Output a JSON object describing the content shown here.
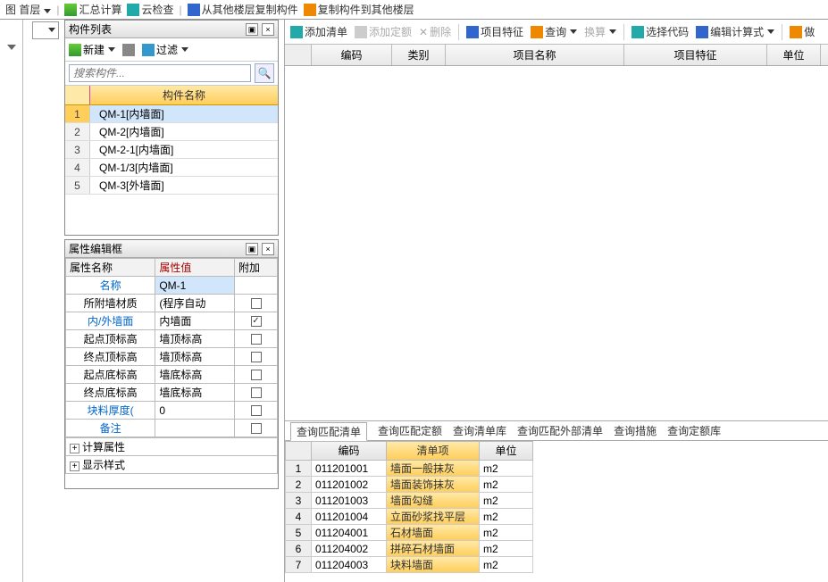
{
  "top_menu": {
    "floor_label": "图 首层",
    "summary_calc": "汇总计算",
    "cloud_check": "云检查",
    "copy_from": "从其他楼层复制构件",
    "copy_to": "复制构件到其他楼层"
  },
  "component_panel": {
    "title": "构件列表",
    "new_btn": "新建",
    "filter_btn": "过滤",
    "search_placeholder": "搜索构件...",
    "header": "构件名称",
    "rows": [
      {
        "idx": "1",
        "name": "QM-1[内墙面]"
      },
      {
        "idx": "2",
        "name": "QM-2[内墙面]"
      },
      {
        "idx": "3",
        "name": "QM-2-1[内墙面]"
      },
      {
        "idx": "4",
        "name": "QM-1/3[内墙面]"
      },
      {
        "idx": "5",
        "name": "QM-3[外墙面]"
      }
    ]
  },
  "prop_panel": {
    "title": "属性编辑框",
    "headers": {
      "name": "属性名称",
      "value": "属性值",
      "extra": "附加"
    },
    "rows": [
      {
        "key": "名称",
        "key_link": true,
        "val": "QM-1",
        "sel": true,
        "chk": null
      },
      {
        "key": "所附墙材质",
        "val": "(程序自动",
        "chk": false
      },
      {
        "key": "内/外墙面",
        "key_link": true,
        "val": "内墙面",
        "chk": true
      },
      {
        "key": "起点顶标高",
        "val": "墙顶标高",
        "chk": false
      },
      {
        "key": "终点顶标高",
        "val": "墙顶标高",
        "chk": false
      },
      {
        "key": "起点底标高",
        "val": "墙底标高",
        "chk": false
      },
      {
        "key": "终点底标高",
        "val": "墙底标高",
        "chk": false
      },
      {
        "key": "块料厚度(",
        "key_link": true,
        "val": "0",
        "chk": false
      },
      {
        "key": "备注",
        "key_link": true,
        "val": "",
        "chk": false
      }
    ],
    "tree": [
      {
        "label": "计算属性"
      },
      {
        "label": "显示样式"
      }
    ]
  },
  "right": {
    "toolbar": {
      "add_list": "添加清单",
      "add_quota": "添加定额",
      "delete": "删除",
      "proj_feat": "项目特征",
      "query": "查询",
      "convert": "换算",
      "select_code": "选择代码",
      "edit_calc": "编辑计算式",
      "do_method": "做"
    },
    "grid_headers": {
      "code": "编码",
      "type": "类别",
      "proj_name": "项目名称",
      "proj_feat": "项目特征",
      "unit": "单位"
    },
    "result_tabs": {
      "t1": "查询匹配清单",
      "t2": "查询匹配定额",
      "t3": "查询清单库",
      "t4": "查询匹配外部清单",
      "t5": "查询措施",
      "t6": "查询定额库"
    },
    "result_headers": {
      "code": "编码",
      "item": "清单项",
      "unit": "单位"
    },
    "result_rows": [
      {
        "idx": "1",
        "code": "011201001",
        "item": "墙面一般抹灰",
        "unit": "m2"
      },
      {
        "idx": "2",
        "code": "011201002",
        "item": "墙面装饰抹灰",
        "unit": "m2"
      },
      {
        "idx": "3",
        "code": "011201003",
        "item": "墙面勾缝",
        "unit": "m2"
      },
      {
        "idx": "4",
        "code": "011201004",
        "item": "立面砂浆找平层",
        "unit": "m2"
      },
      {
        "idx": "5",
        "code": "011204001",
        "item": "石材墙面",
        "unit": "m2"
      },
      {
        "idx": "6",
        "code": "011204002",
        "item": "拼碎石材墙面",
        "unit": "m2"
      },
      {
        "idx": "7",
        "code": "011204003",
        "item": "块料墙面",
        "unit": "m2"
      }
    ]
  }
}
